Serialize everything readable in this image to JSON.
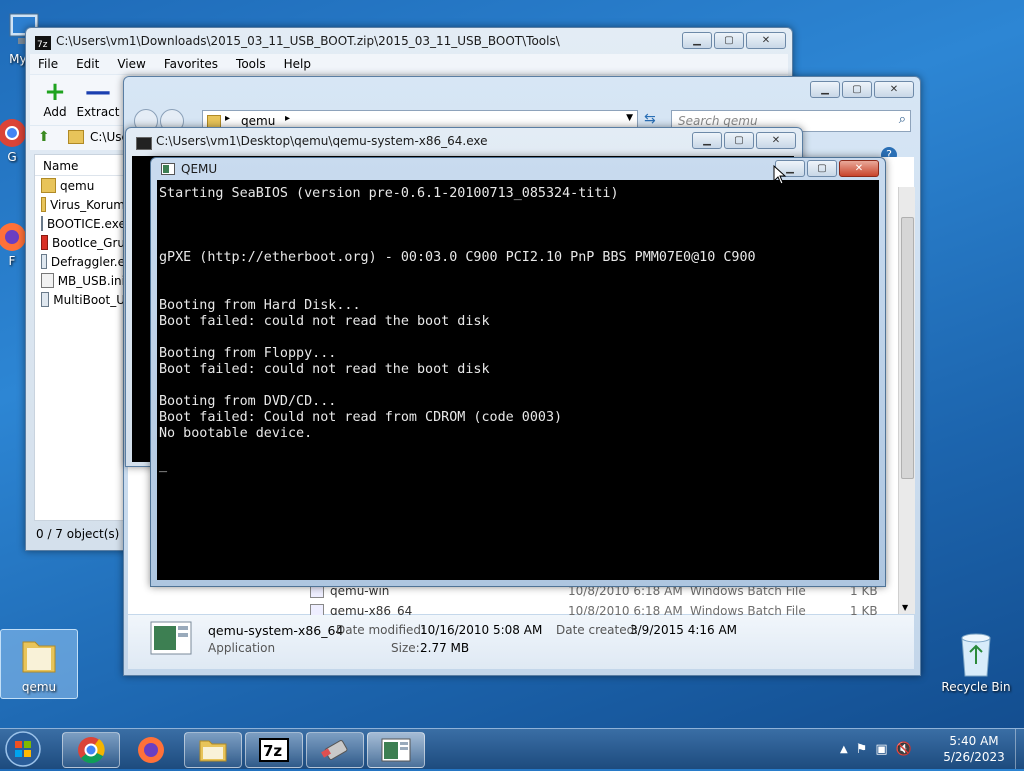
{
  "desktop": {
    "icons": [
      {
        "label": "My C",
        "icon": "computer-icon"
      },
      {
        "label": "G",
        "icon": "chrome-icon"
      },
      {
        "label": "F",
        "icon": "firefox-icon"
      },
      {
        "label": "qemu",
        "icon": "folder-icon"
      },
      {
        "label": "Recycle Bin",
        "icon": "recycle-bin-icon"
      }
    ]
  },
  "zip_window": {
    "title": "C:\\Users\\vm1\\Downloads\\2015_03_11_USB_BOOT.zip\\2015_03_11_USB_BOOT\\Tools\\",
    "menu": [
      "File",
      "Edit",
      "View",
      "Favorites",
      "Tools",
      "Help"
    ],
    "toolbar": {
      "add": "Add",
      "extract": "Extract"
    },
    "address": "C:\\Use",
    "column_name": "Name",
    "files": [
      "qemu",
      "Virus_Korum",
      "BOOTICE.exe",
      "BootIce_Gru",
      "Defraggler.e",
      "MB_USB.ini",
      "MultiBoot_U"
    ],
    "status": "0 / 7 object(s) se"
  },
  "explorer_window": {
    "breadcrumb": "qemu",
    "search_placeholder": "Search qemu",
    "rows": [
      {
        "name": "qemu-win",
        "date": "10/8/2010 6:18 AM",
        "type": "Windows Batch File",
        "size": "1 KB"
      },
      {
        "name": "qemu-x86_64",
        "date": "10/8/2010 6:18 AM",
        "type": "Windows Batch File",
        "size": "1 KB"
      }
    ],
    "details": {
      "name": "qemu-system-x86_64",
      "type": "Application",
      "modified_label": "Date modified:",
      "modified": "10/16/2010 5:08 AM",
      "created_label": "Date created:",
      "created": "3/9/2015 4:16 AM",
      "size_label": "Size:",
      "size": "2.77 MB"
    }
  },
  "console_window": {
    "title": "C:\\Users\\vm1\\Desktop\\qemu\\qemu-system-x86_64.exe"
  },
  "qemu_window": {
    "title": "QEMU",
    "screen_lines": [
      "Starting SeaBIOS (version pre-0.6.1-20100713_085324-titi)",
      "",
      "",
      "",
      "gPXE (http://etherboot.org) - 00:03.0 C900 PCI2.10 PnP BBS PMM07E0@10 C900",
      "",
      "",
      "Booting from Hard Disk...",
      "Boot failed: could not read the boot disk",
      "",
      "Booting from Floppy...",
      "Boot failed: could not read the boot disk",
      "",
      "Booting from DVD/CD...",
      "Boot failed: Could not read from CDROM (code 0003)",
      "No bootable device.",
      "",
      "_"
    ]
  },
  "taskbar": {
    "clock_time": "5:40 AM",
    "clock_date": "5/26/2023",
    "apps": [
      "start-orb",
      "chrome",
      "firefox",
      "explorer",
      "7zip",
      "usb-tool",
      "qemu"
    ]
  }
}
